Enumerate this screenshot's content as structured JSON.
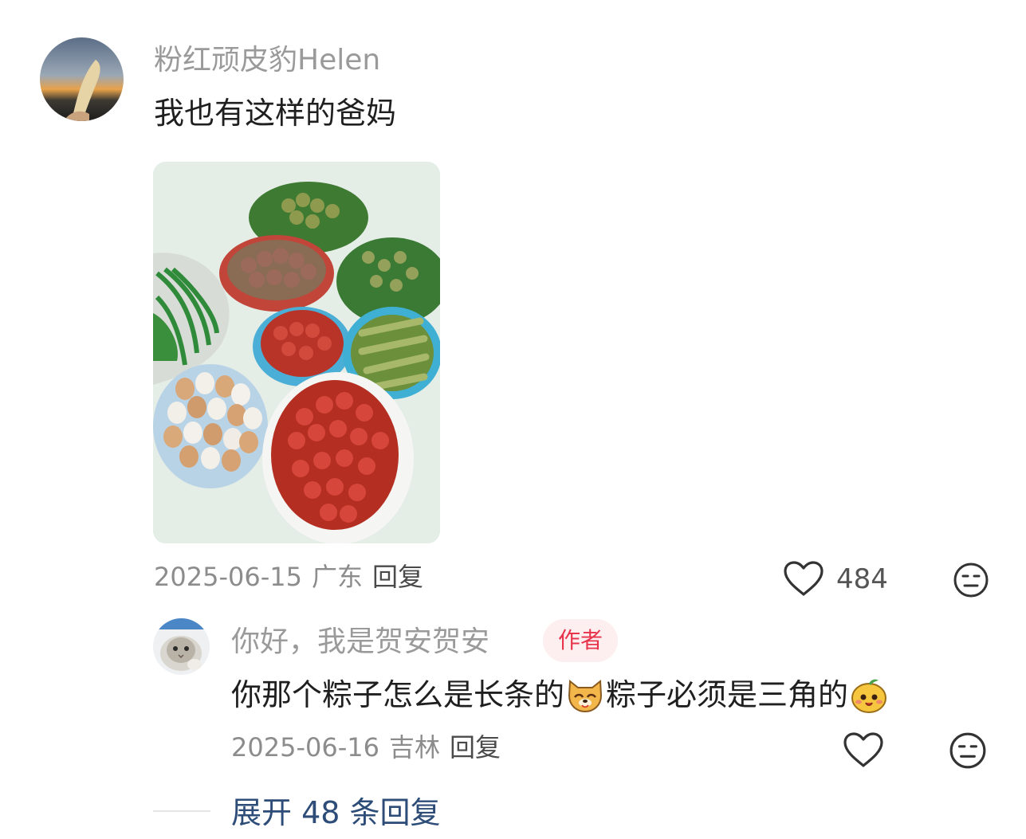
{
  "comment": {
    "username": "粉红顽皮豹Helen",
    "text": "我也有这样的爸妈",
    "date": "2025-06-15",
    "location": "广东",
    "reply_label": "回复",
    "likes": "484"
  },
  "reply": {
    "username": "你好，我是贺安贺安",
    "badge": "作者",
    "text_part1": "你那个粽子怎么是长条的",
    "text_part2": "粽子必须是三角的",
    "emoji1": "dog-face-emoji",
    "emoji2": "fruit-face-emoji",
    "date": "2025-06-16",
    "location": "吉林",
    "reply_label": "回复"
  },
  "expand_replies": {
    "label": "展开 48 条回复"
  },
  "colors": {
    "badge_text": "#e8344b",
    "badge_bg": "#fdeef0",
    "expand_link": "#2d4d78"
  }
}
